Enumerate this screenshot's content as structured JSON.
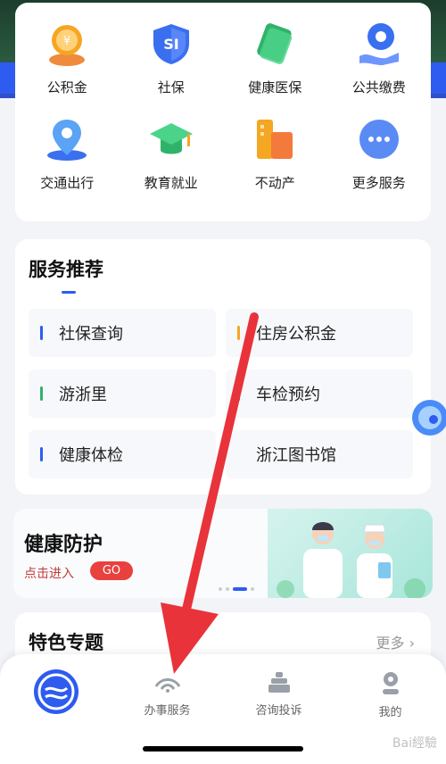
{
  "services": [
    {
      "label": "公积金",
      "icon": "housing-fund-icon"
    },
    {
      "label": "社保",
      "icon": "social-security-icon",
      "icon_text": "SI"
    },
    {
      "label": "健康医保",
      "icon": "health-insurance-icon"
    },
    {
      "label": "公共缴费",
      "icon": "public-payment-icon"
    },
    {
      "label": "交通出行",
      "icon": "transport-icon"
    },
    {
      "label": "教育就业",
      "icon": "education-icon"
    },
    {
      "label": "不动产",
      "icon": "real-estate-icon"
    },
    {
      "label": "更多服务",
      "icon": "more-services-icon"
    }
  ],
  "recommend": {
    "title": "服务推荐",
    "items": [
      {
        "label": "社保查询",
        "color": "#2e5cf0"
      },
      {
        "label": "住房公积金",
        "color": "#f5a623"
      },
      {
        "label": "游浙里",
        "color": "#2fb36a"
      },
      {
        "label": "车检预约",
        "color": "#2e5cf0"
      },
      {
        "label": "健康体检",
        "color": "#2e5cf0"
      },
      {
        "label": "浙江图书馆",
        "color": "#2e5cf0"
      }
    ]
  },
  "banner": {
    "title": "健康防护",
    "subtitle": "点击进入",
    "go_label": "GO"
  },
  "featured": {
    "title": "特色专题",
    "more_label": "更多 ›"
  },
  "tabbar": {
    "tabs": [
      {
        "label": "",
        "icon": "home-logo-icon"
      },
      {
        "label": "办事服务",
        "icon": "service-icon"
      },
      {
        "label": "咨询投诉",
        "icon": "consult-icon"
      },
      {
        "label": "我的",
        "icon": "profile-icon"
      }
    ]
  },
  "watermark": "Bai經驗"
}
